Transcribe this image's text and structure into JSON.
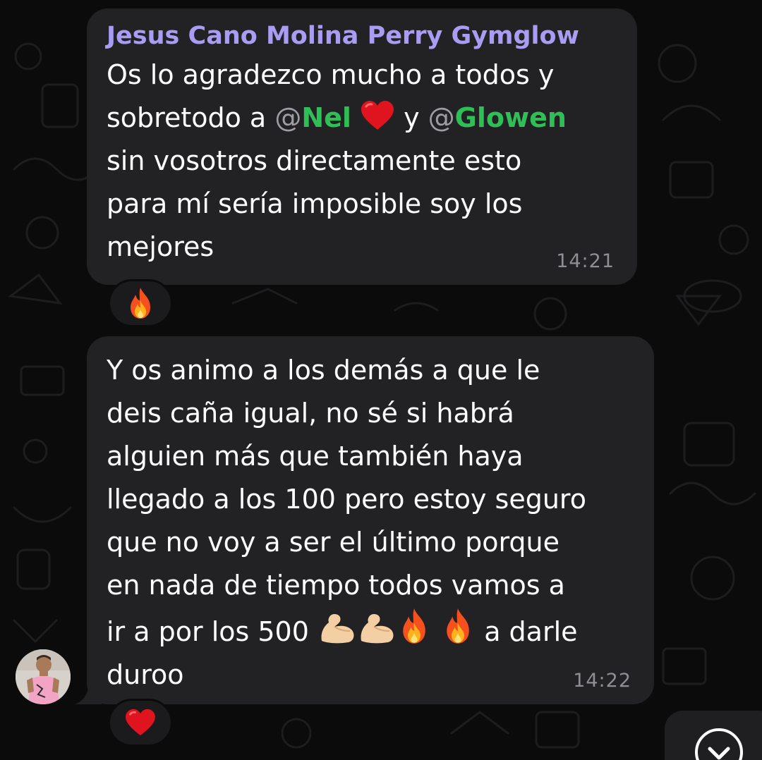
{
  "messages": [
    {
      "sender": "Jesus Cano Molina Perry Gymglow",
      "line1": "Os lo agradezco mucho a todos y",
      "line2_prefix": "sobretodo a ",
      "mention1_at": "@",
      "mention1_name": "Nel",
      "line2_mid": " y ",
      "mention2_at": "@",
      "mention2_name": "Glowen",
      "line3": "sin vosotros directamente esto",
      "line4": "para mí sería imposible soy los",
      "line5": "mejores",
      "time": "14:21",
      "reaction": "fire"
    },
    {
      "line1": "Y os animo a los demás a que le",
      "line2": "deis caña igual, no sé si habrá",
      "line3": "alguien más que también haya",
      "line4": "llegado a los 100 pero estoy seguro",
      "line5": "que no voy a ser el último porque",
      "line6": "en nada de tiempo todos vamos a",
      "line7_prefix": "ir a por los 500",
      "line7_suffix": " a darle",
      "line8": "duroo",
      "time": "14:22",
      "reaction": "red-heart"
    }
  ],
  "colors": {
    "bubble": "#222224",
    "sender_name": "#a99cf3",
    "mention": "#2fbf57",
    "timestamp": "#8e8e93"
  }
}
